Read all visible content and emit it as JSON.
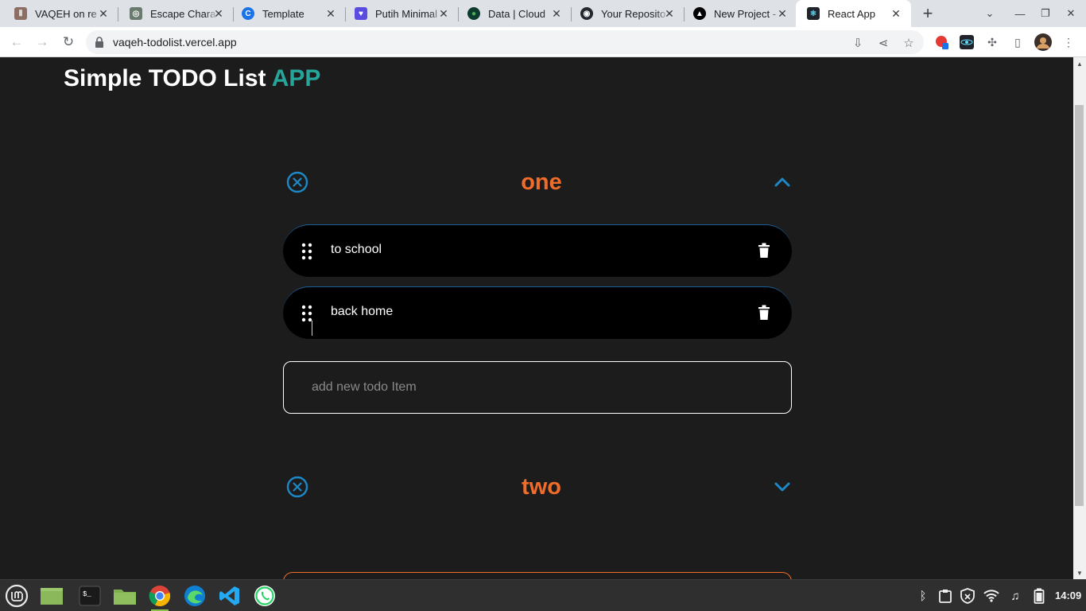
{
  "browser": {
    "tabs": [
      {
        "title": "VAQEH on re",
        "favicon": "vaqeh-favicon",
        "color": "#8d6e63"
      },
      {
        "title": "Escape Chara",
        "favicon": "chatgpt-favicon",
        "color": "#6b7a6f"
      },
      {
        "title": "Template",
        "favicon": "canva-favicon",
        "color": "#1a73e8"
      },
      {
        "title": "Putih Minimal",
        "favicon": "heart-favicon",
        "color": "#5b4ce0"
      },
      {
        "title": "Data | Cloud",
        "favicon": "mongodb-favicon",
        "color": "#0d3b2e"
      },
      {
        "title": "Your Reposito",
        "favicon": "github-favicon",
        "color": "#24292f"
      },
      {
        "title": "New Project -",
        "favicon": "vercel-favicon",
        "color": "#000000"
      },
      {
        "title": "React App",
        "favicon": "react-favicon",
        "color": "#20232a"
      }
    ],
    "active_tab": 7,
    "url": "vaqeh-todolist.vercel.app"
  },
  "app": {
    "title_main": "Simple TODO List ",
    "title_accent": "APP",
    "accent_color": "#26a69a",
    "group_title_color": "#ef6c2a",
    "icon_color": "#1e88c7",
    "groups": [
      {
        "title": "one",
        "expanded": true,
        "items": [
          "to school",
          "back home"
        ],
        "input_placeholder": "add new todo Item"
      },
      {
        "title": "two",
        "expanded": false
      }
    ]
  },
  "taskbar": {
    "apps": [
      "mint-menu-icon",
      "files-green-icon",
      "terminal-icon",
      "folder-icon",
      "chrome-icon",
      "edge-icon",
      "vscode-icon",
      "whatsapp-icon"
    ],
    "clock": "14:09"
  }
}
